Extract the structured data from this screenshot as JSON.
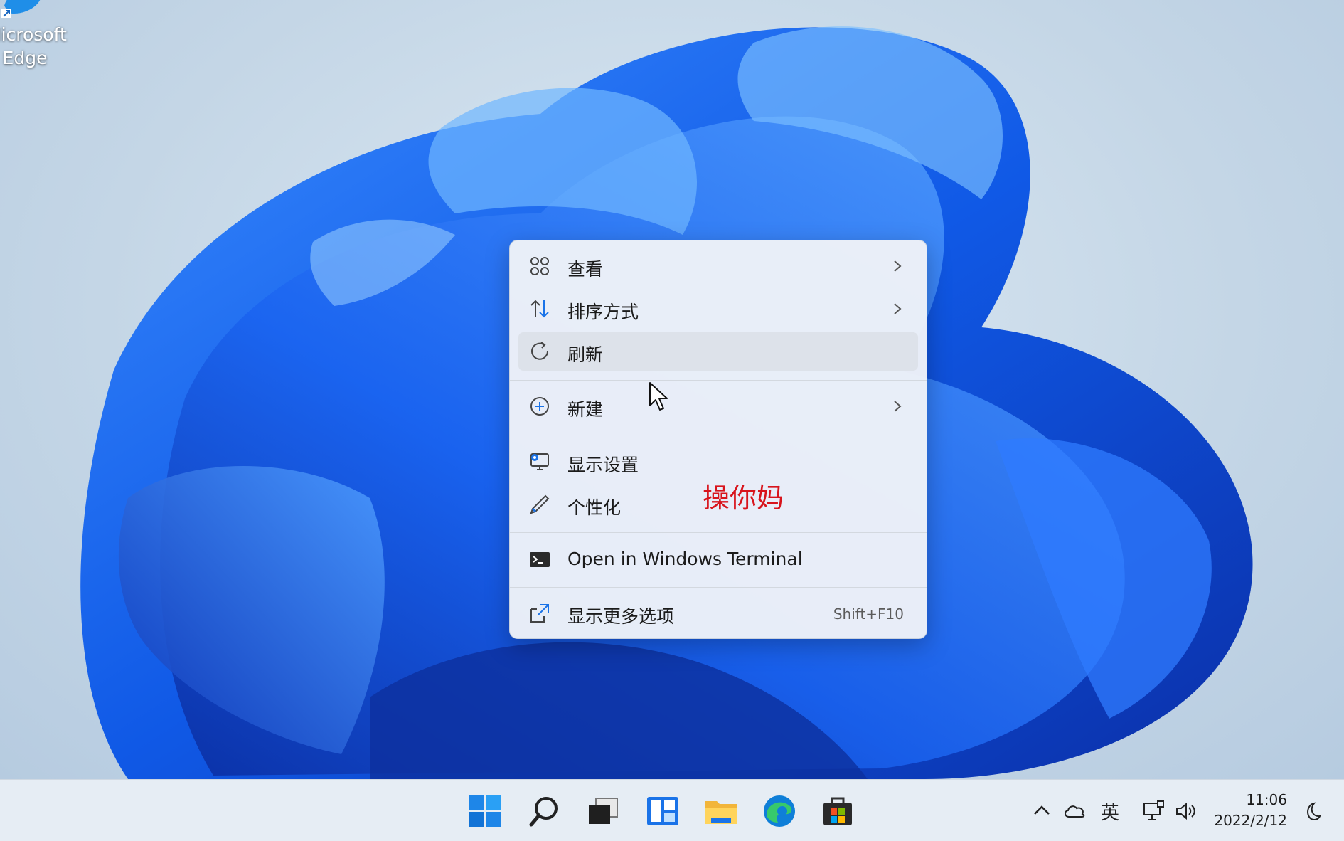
{
  "desktop": {
    "icon_edge": {
      "label_line1": "Microsoft",
      "label_line2": "Edge"
    }
  },
  "context_menu": {
    "items": [
      {
        "label": "查看",
        "icon": "grid-view-icon",
        "has_submenu": true
      },
      {
        "label": "排序方式",
        "icon": "sort-arrows-icon",
        "has_submenu": true
      },
      {
        "label": "刷新",
        "icon": "refresh-icon",
        "has_submenu": false,
        "highlighted": true
      },
      {
        "label": "新建",
        "icon": "plus-circle-icon",
        "has_submenu": true
      },
      {
        "label": "显示设置",
        "icon": "display-settings-icon",
        "has_submenu": false
      },
      {
        "label": "个性化",
        "icon": "pen-icon",
        "has_submenu": false
      },
      {
        "label": "Open in Windows Terminal",
        "icon": "terminal-icon",
        "has_submenu": false
      },
      {
        "label": "显示更多选项",
        "icon": "expand-icon",
        "has_submenu": false,
        "shortcut": "Shift+F10"
      }
    ]
  },
  "overlay_text": "操你妈",
  "taskbar": {
    "apps": [
      "start-icon",
      "search-icon",
      "task-view-icon",
      "widgets-icon",
      "file-explorer-icon",
      "edge-icon",
      "store-icon"
    ],
    "tray": {
      "ime": "英",
      "time": "11:06",
      "date": "2022/2/12"
    }
  },
  "colors": {
    "accent": "#0078d4",
    "overlay_text": "#d8141c"
  }
}
